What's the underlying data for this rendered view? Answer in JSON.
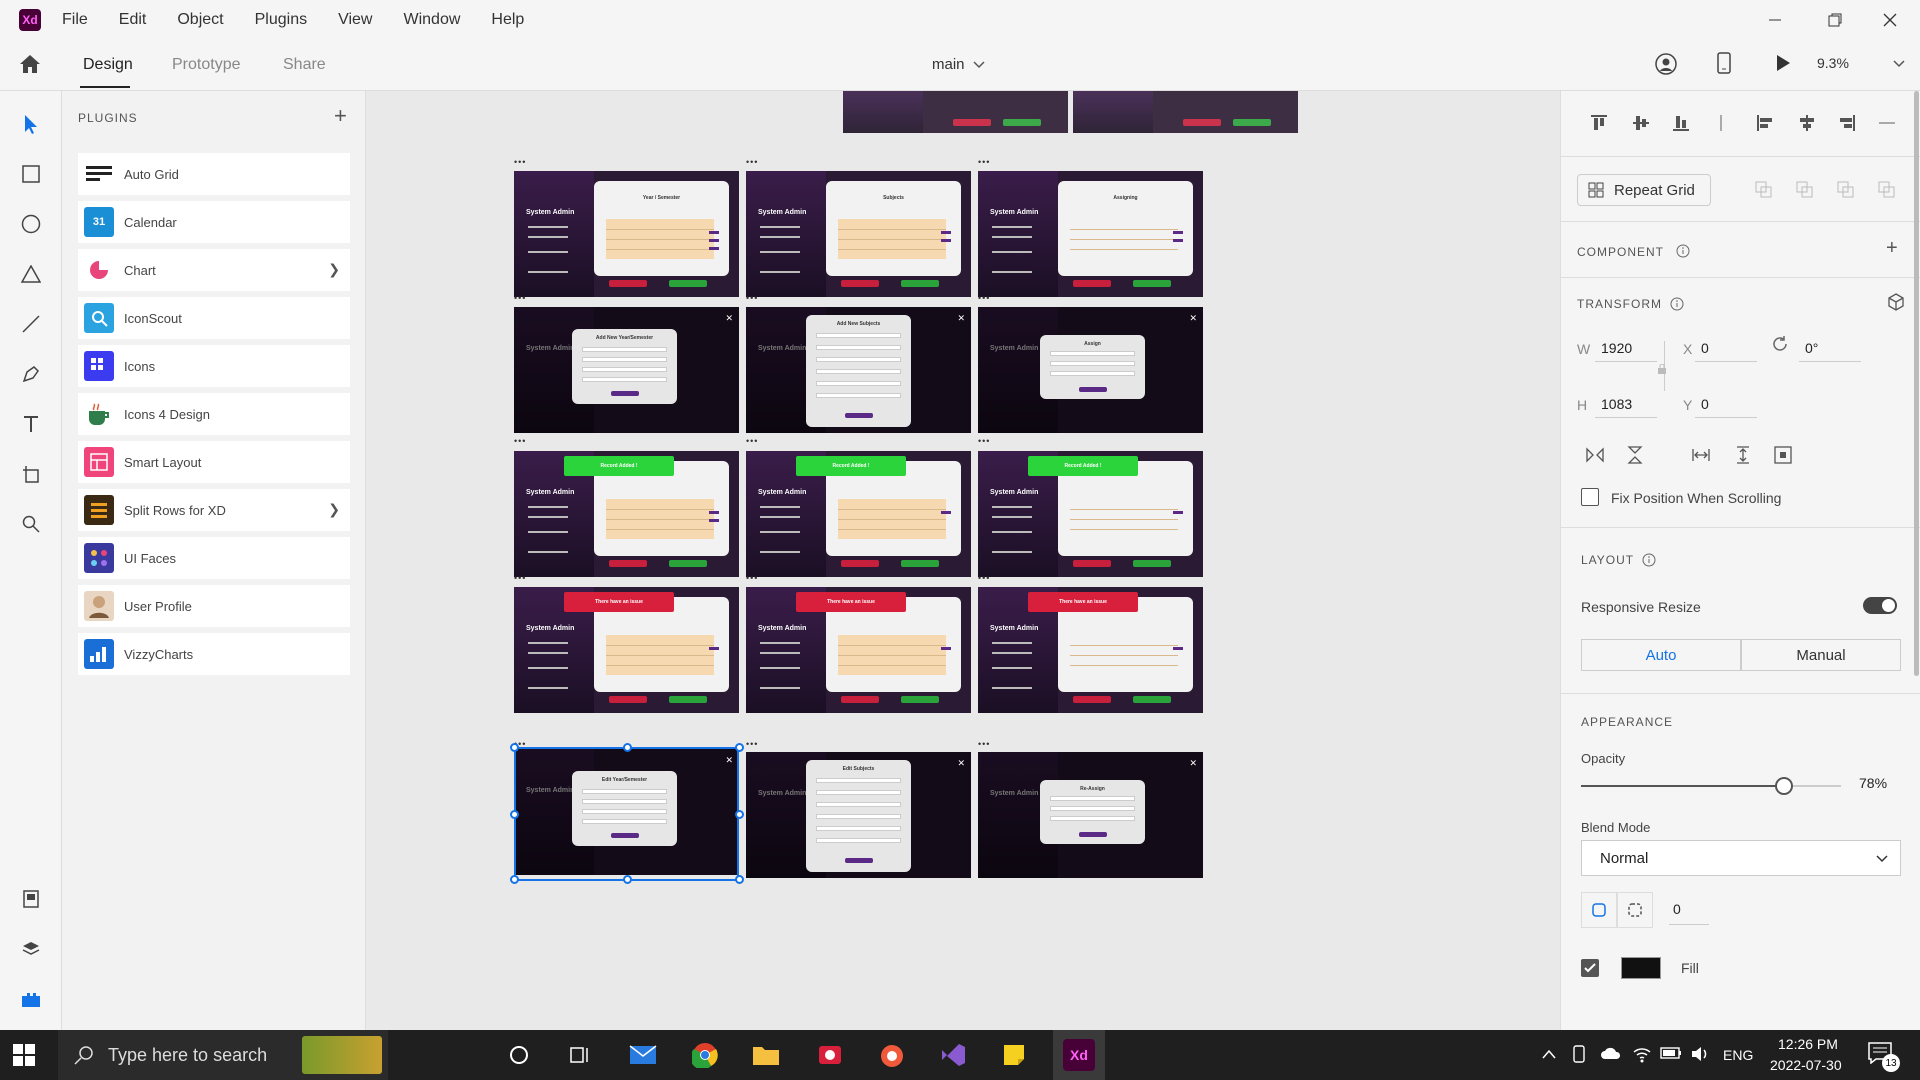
{
  "app": {
    "logo": "Xd",
    "menus": [
      "File",
      "Edit",
      "Object",
      "Plugins",
      "View",
      "Window",
      "Help"
    ]
  },
  "tabs": {
    "design": "Design",
    "prototype": "Prototype",
    "share": "Share",
    "document": "main",
    "zoom": "9.3%"
  },
  "plugins": {
    "title": "PLUGINS",
    "items": [
      {
        "label": "Auto Grid",
        "icon": "auto-grid-icon",
        "color": "#222222"
      },
      {
        "label": "Calendar",
        "icon": "calendar-icon",
        "color": "#1a8fd6",
        "text": "31"
      },
      {
        "label": "Chart",
        "icon": "chart-icon",
        "color": "#e8457a"
      },
      {
        "label": "IconScout",
        "icon": "iconscout-icon",
        "color": "#2aa3e0"
      },
      {
        "label": "Icons",
        "icon": "icons-icon",
        "color": "#3b3bf0"
      },
      {
        "label": "Icons 4 Design",
        "icon": "icons4design-icon",
        "color": "#2f7d4a"
      },
      {
        "label": "Smart Layout",
        "icon": "smart-layout-icon",
        "color": "#f0457a"
      },
      {
        "label": "Split Rows for XD",
        "icon": "split-rows-icon",
        "color": "#3a2a14"
      },
      {
        "label": "UI Faces",
        "icon": "ui-faces-icon",
        "color": "#3a3a9e"
      },
      {
        "label": "User Profile",
        "icon": "user-profile-icon",
        "color": "#c9a17a"
      },
      {
        "label": "VizzyCharts",
        "icon": "vizzycharts-icon",
        "color": "#1a6fd6"
      }
    ]
  },
  "artboards": {
    "sidebar_title": "System Admin",
    "row1": [
      "Year / Semester",
      "Subjects",
      "Assigning"
    ],
    "row2": [
      "Add New Year/Semester",
      "Add New Subjects",
      "Assign"
    ],
    "toast_success": "Record Added !",
    "toast_error": "There have an issue",
    "row5": [
      "Edit Year/Semester",
      "Edit Subjects",
      "Re-Assign"
    ]
  },
  "right_panel": {
    "repeat_grid": "Repeat Grid",
    "component": "COMPONENT",
    "transform": "TRANSFORM",
    "w_label": "W",
    "w_value": "1920",
    "h_label": "H",
    "h_value": "1083",
    "x_label": "X",
    "x_value": "0",
    "y_label": "Y",
    "y_value": "0",
    "rotation": "0°",
    "fix_position": "Fix Position When Scrolling",
    "layout": "LAYOUT",
    "responsive_resize": "Responsive Resize",
    "responsive_on": true,
    "auto": "Auto",
    "manual": "Manual",
    "appearance": "APPEARANCE",
    "opacity_label": "Opacity",
    "opacity_value": "78%",
    "opacity_fraction": 0.78,
    "blend_label": "Blend Mode",
    "blend_value": "Normal",
    "corner_value": "0",
    "fill_label": "Fill",
    "fill_color": "#111111"
  },
  "taskbar": {
    "search_placeholder": "Type here to search",
    "lang": "ENG",
    "time": "12:26 PM",
    "date": "2022-07-30",
    "notifications": "13"
  }
}
